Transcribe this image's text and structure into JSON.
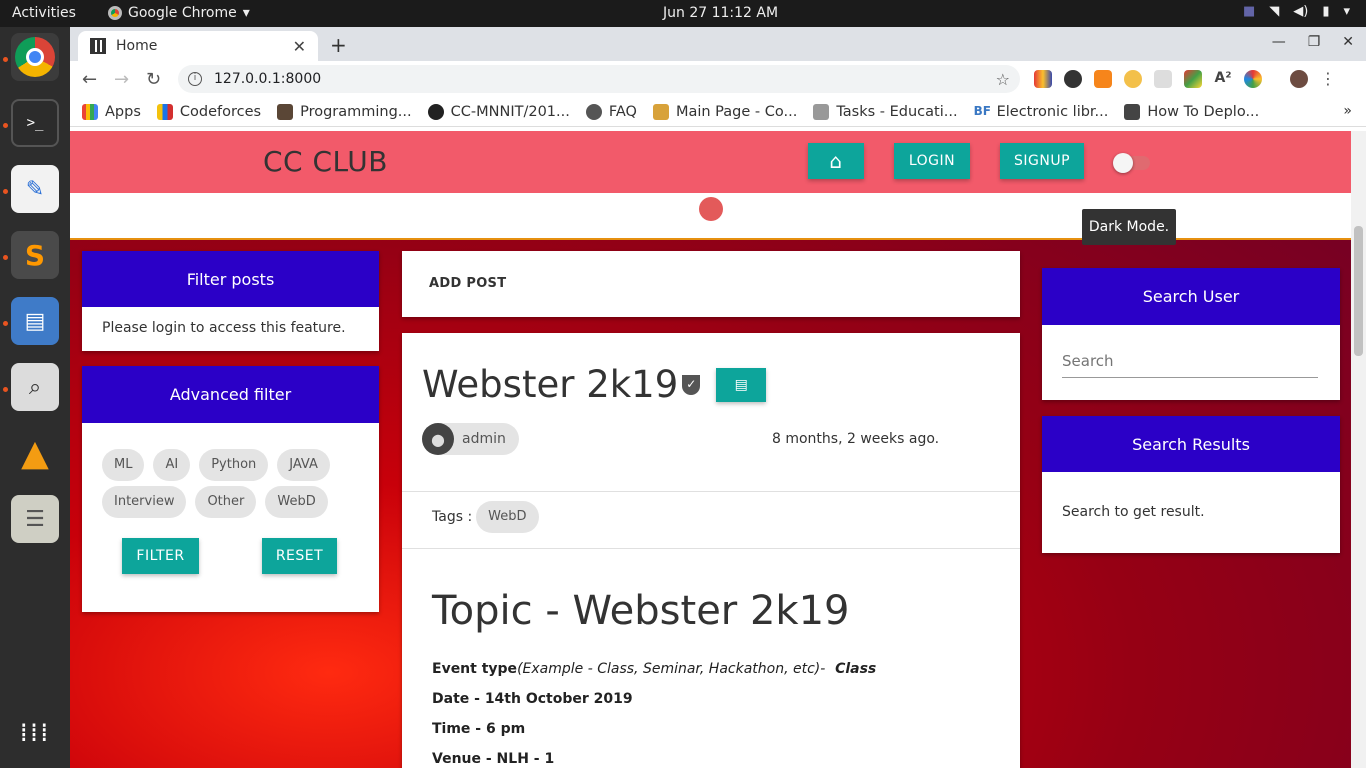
{
  "os": {
    "activities": "Activities",
    "app_name": "Google Chrome",
    "clock": "Jun 27  11:12 AM"
  },
  "browser": {
    "tab_title": "Home",
    "url": "127.0.0.1:8000",
    "bookmarks": [
      "Apps",
      "Codeforces",
      "Programming...",
      "CC-MNNIT/201...",
      "FAQ",
      "Main Page - Co...",
      "Tasks - Educati...",
      "Electronic libr...",
      "How To Deplo..."
    ]
  },
  "site": {
    "brand": "CC CLUB",
    "login": "LOGIN",
    "signup": "SIGNUP",
    "tooltip": "Dark Mode."
  },
  "left": {
    "filter_title": "Filter posts",
    "filter_msg": "Please login to access this feature.",
    "adv_title": "Advanced filter",
    "tags": [
      "ML",
      "AI",
      "Python",
      "JAVA",
      "Interview",
      "Other",
      "WebD"
    ],
    "filter_btn": "FILTER",
    "reset_btn": "RESET"
  },
  "center": {
    "add_post": "ADD POST",
    "post_title": "Webster 2k19",
    "author": "admin",
    "time_ago": "8 months, 2 weeks ago.",
    "tags_label": "Tags :",
    "tag": "WebD",
    "topic": "Topic - Webster 2k19",
    "event_type_label": "Event type",
    "event_type_example": "(Example - Class, Seminar, Hackathon, etc)-",
    "event_type_value": "Class",
    "date": "Date - 14th October 2019",
    "time": "Time - 6 pm",
    "venue": "Venue - NLH - 1"
  },
  "right": {
    "search_title": "Search User",
    "search_placeholder": "Search",
    "results_title": "Search Results",
    "results_msg": "Search to get result."
  }
}
